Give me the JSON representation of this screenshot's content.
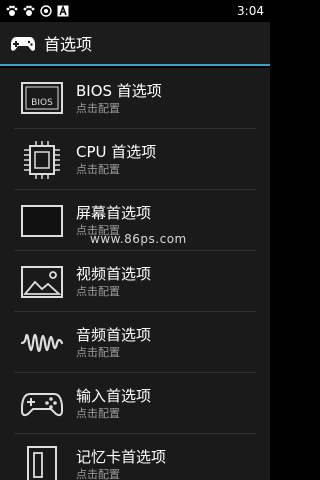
{
  "status_bar": {
    "time": "3:04",
    "icons": [
      "paw-icon",
      "paw-icon",
      "record-icon",
      "a-icon"
    ]
  },
  "action_bar": {
    "title": "首选项",
    "icon": "gamepad-icon"
  },
  "items": [
    {
      "title": "BIOS 首选项",
      "subtitle": "点击配置",
      "icon": "bios-chip-icon",
      "icon_text": "BIOS"
    },
    {
      "title": "CPU 首选项",
      "subtitle": "点击配置",
      "icon": "cpu-icon"
    },
    {
      "title": "屏幕首选项",
      "subtitle": "点击配置",
      "icon": "screen-icon"
    },
    {
      "title": "视频首选项",
      "subtitle": "点击配置",
      "icon": "picture-icon"
    },
    {
      "title": "音频首选项",
      "subtitle": "点击配置",
      "icon": "audio-wave-icon"
    },
    {
      "title": "输入首选项",
      "subtitle": "点击配置",
      "icon": "gamepad-icon"
    },
    {
      "title": "记忆卡首选项",
      "subtitle": "点击配置",
      "icon": "memory-card-icon"
    }
  ],
  "watermark": "www.86ps.com",
  "colors": {
    "accent": "#3aa0c8",
    "background": "#1a1a1a",
    "subtitle": "#9a9a9a"
  }
}
